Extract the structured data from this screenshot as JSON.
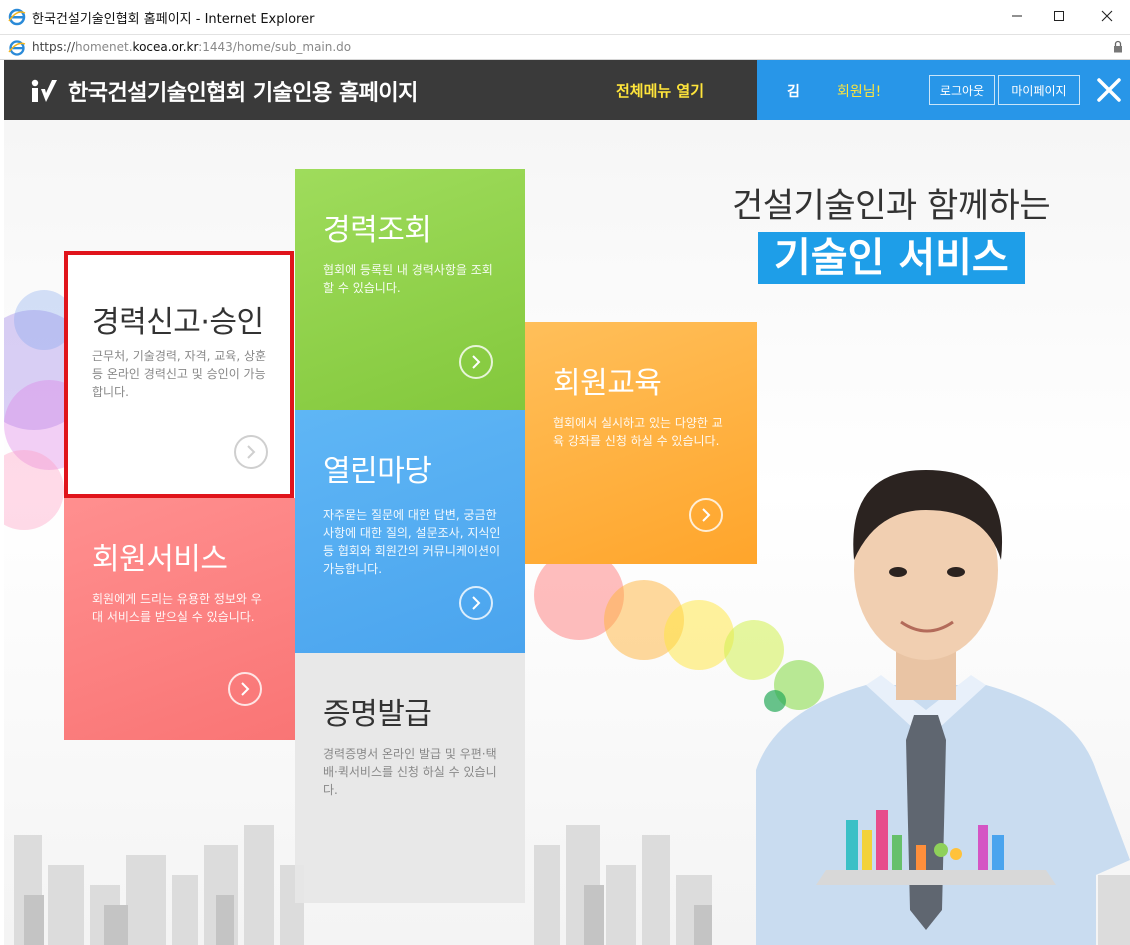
{
  "window": {
    "title": "한국건설기술인협회 홈페이지 - Internet Explorer",
    "icon": "ie-icon",
    "controls": [
      "minimize-icon",
      "maximize-icon",
      "close-icon"
    ]
  },
  "address": {
    "protocol": "https://",
    "subdomain": "homenet.",
    "domain": "kocea.or.kr",
    "rest": ":1443/home/sub_main.do",
    "lock_icon": "lock-icon"
  },
  "header": {
    "logo_icon": "kocea-logo-icon",
    "site_title": "한국건설기술인협회 기술인용 홈페이지",
    "menu_open": "전체메뉴 열기",
    "user_name": "김",
    "user_suffix": "회원님!",
    "logout": "로그아웃",
    "mypage": "마이페이지",
    "close_icon": "close-icon",
    "colors": {
      "dark": "#3a3a3a",
      "accent": "#2896e8",
      "highlight": "#ffe53b"
    }
  },
  "hero": {
    "line1": "건설기술인과 함께하는",
    "line2": "기술인 서비스"
  },
  "tiles": {
    "career_report": {
      "title": "경력신고·승인",
      "desc": "근무처, 기술경력, 자격, 교육, 상훈 등 온라인 경력신고 및 승인이 가능합니다.",
      "color": "#ffffff",
      "highlight_border": "#e0141b"
    },
    "career_view": {
      "title": "경력조회",
      "desc": "협회에 등록된 내 경력사항을 조회 할 수 있습니다.",
      "color": "#8fd048"
    },
    "education": {
      "title": "회원교육",
      "desc": "협회에서 실시하고 있는 다양한 교육 강좌를 신청 하실 수 있습니다.",
      "color": "#ffaa33"
    },
    "forum": {
      "title": "열린마당",
      "desc": "자주묻는 질문에 대한 답변, 궁금한 사항에 대한 질의, 설문조사, 지식인 등 협회와 회원간의 커뮤니케이션이 가능합니다.",
      "color": "#52aaf0"
    },
    "member_service": {
      "title": "회원서비스",
      "desc": "회원에게 드리는 유용한 정보와 우대 서비스를 받으실 수 있습니다.",
      "color": "#fb7e7e"
    },
    "certificate": {
      "title": "증명발급",
      "desc": "경력증명서 온라인 발급 및 우편·택배·퀵서비스를 신청 하실 수 있습니다.",
      "color": "#e6e6e6"
    }
  }
}
